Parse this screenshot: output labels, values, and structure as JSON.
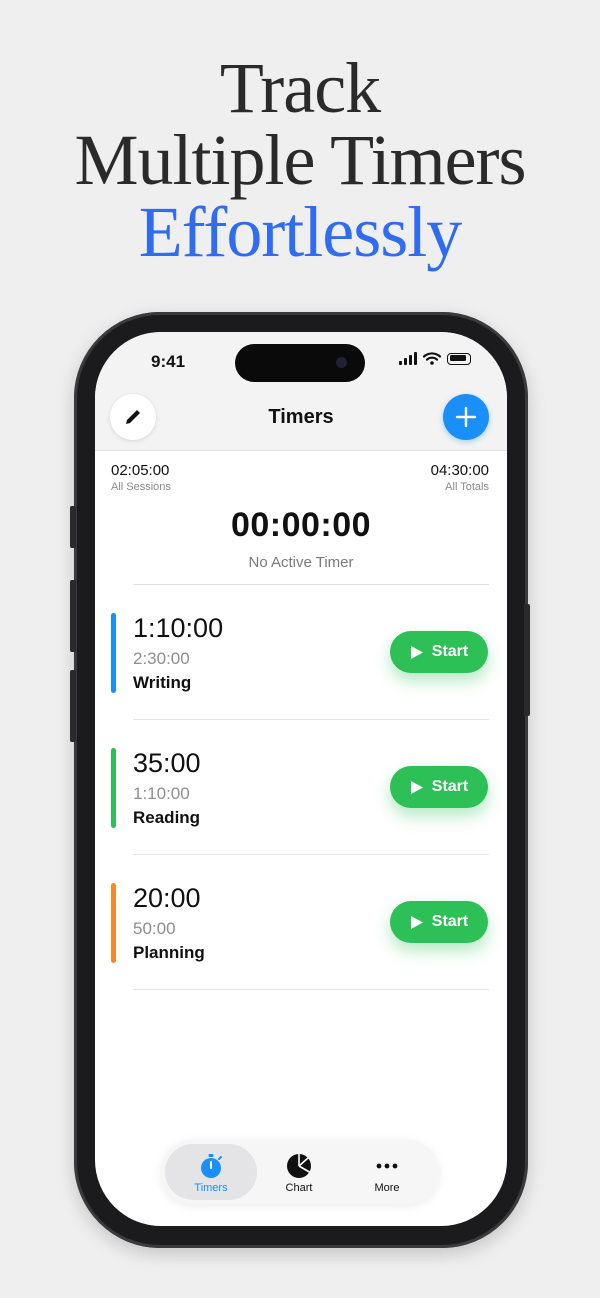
{
  "headline": {
    "line1": "Track",
    "line2": "Multiple Timers",
    "line3": "Effortlessly"
  },
  "status_bar": {
    "time": "9:41"
  },
  "nav": {
    "title": "Timers",
    "edit_icon": "pencil-icon",
    "add_icon": "plus-icon"
  },
  "summary": {
    "sessions_value": "02:05:00",
    "sessions_label": "All Sessions",
    "totals_value": "04:30:00",
    "totals_label": "All Totals",
    "active_time": "00:00:00",
    "active_label": "No Active Timer"
  },
  "timers": [
    {
      "elapsed": "1:10:00",
      "total": "2:30:00",
      "name": "Writing",
      "color": "#1a8ff7",
      "button": "Start"
    },
    {
      "elapsed": "35:00",
      "total": "1:10:00",
      "name": "Reading",
      "color": "#2cc057",
      "button": "Start"
    },
    {
      "elapsed": "20:00",
      "total": "50:00",
      "name": "Planning",
      "color": "#f5892a",
      "button": "Start"
    }
  ],
  "tabs": [
    {
      "label": "Timers",
      "icon": "stopwatch-icon",
      "active": true
    },
    {
      "label": "Chart",
      "icon": "pie-chart-icon",
      "active": false
    },
    {
      "label": "More",
      "icon": "ellipsis-icon",
      "active": false
    }
  ],
  "colors": {
    "accent": "#1a8ff7",
    "start": "#2cc057",
    "headline_accent": "#2f6cf1"
  }
}
